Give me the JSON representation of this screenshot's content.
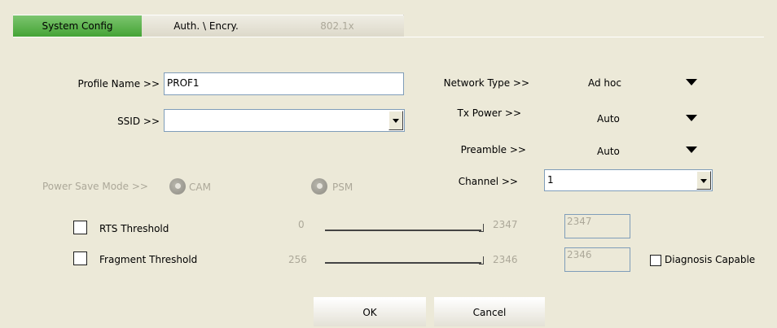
{
  "tabs": {
    "system_config": "System Config",
    "auth_encry": "Auth. \\ Encry.",
    "dot1x": "802.1x"
  },
  "profile": {
    "profile_name_label": "Profile Name >>",
    "profile_name_value": "PROF1",
    "ssid_label": "SSID >>",
    "ssid_value": "",
    "power_save_label": "Power Save Mode >>",
    "cam_label": "CAM",
    "psm_label": "PSM"
  },
  "network": {
    "network_type_label": "Network Type >>",
    "network_type_value": "Ad hoc",
    "tx_power_label": "Tx Power >>",
    "tx_power_value": "Auto",
    "preamble_label": "Preamble >>",
    "preamble_value": "Auto",
    "channel_label": "Channel >>",
    "channel_value": "1"
  },
  "thresholds": {
    "rts": {
      "label": "RTS Threshold",
      "min": "0",
      "max": "2347",
      "value": "2347"
    },
    "fragment": {
      "label": "Fragment Threshold",
      "min": "256",
      "max": "2346",
      "value": "2346"
    }
  },
  "diagnosis_label": "Diagnosis Capable",
  "buttons": {
    "ok": "OK",
    "cancel": "Cancel"
  },
  "colors": {
    "active_tab": "#43a233",
    "disabled_text": "#aca899",
    "background": "#ece9d8"
  }
}
